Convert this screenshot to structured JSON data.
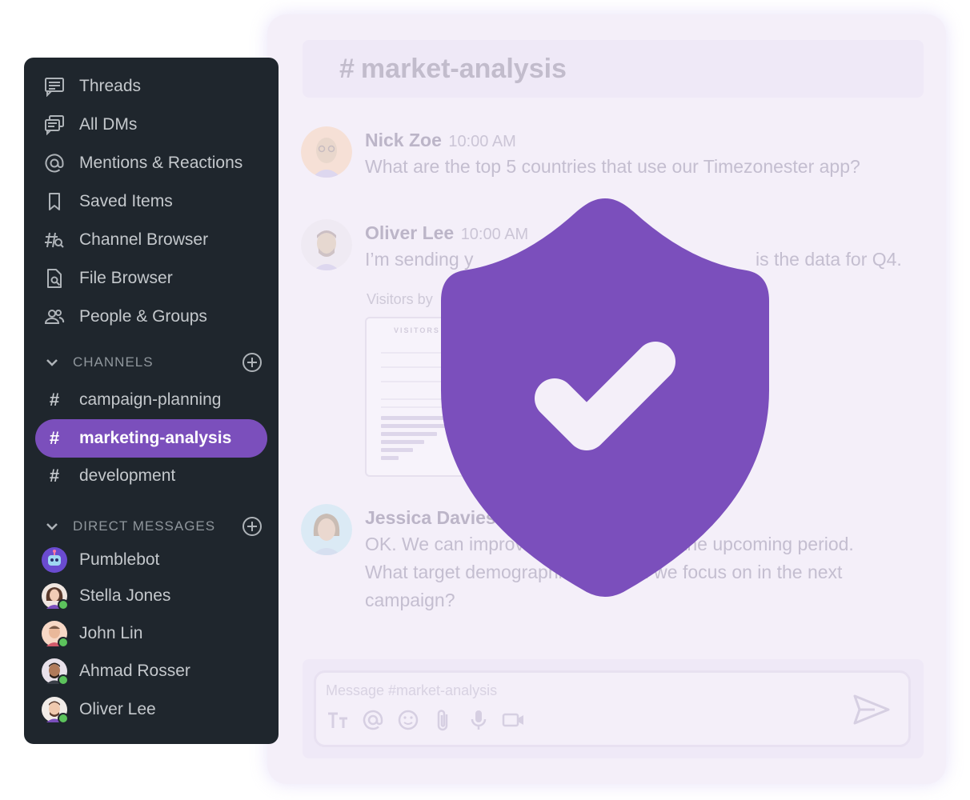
{
  "sidebar": {
    "nav": [
      {
        "label": "Threads",
        "icon": "threads-icon"
      },
      {
        "label": "All DMs",
        "icon": "all-dms-icon"
      },
      {
        "label": "Mentions & Reactions",
        "icon": "at-icon"
      },
      {
        "label": "Saved Items",
        "icon": "bookmark-icon"
      },
      {
        "label": "Channel Browser",
        "icon": "channel-browser-icon"
      },
      {
        "label": "File Browser",
        "icon": "file-search-icon"
      },
      {
        "label": "People & Groups",
        "icon": "people-icon"
      }
    ],
    "channels_header": "CHANNELS",
    "channels": [
      {
        "name": "campaign-planning",
        "active": false
      },
      {
        "name": "marketing-analysis",
        "active": true
      },
      {
        "name": "development",
        "active": false
      }
    ],
    "dms_header": "DIRECT MESSAGES",
    "dms": [
      {
        "name": "Pumblebot",
        "online": false
      },
      {
        "name": "Stella Jones",
        "online": true
      },
      {
        "name": "John Lin",
        "online": true
      },
      {
        "name": "Ahmad Rosser",
        "online": true
      },
      {
        "name": "Oliver Lee",
        "online": true
      }
    ]
  },
  "chat": {
    "channel_hash": "#",
    "channel_name": "market-analysis",
    "messages": [
      {
        "author": "Nick Zoe",
        "time": "10:00 AM",
        "text": "What are the top 5 countries that use our Timezonester app?"
      },
      {
        "author": "Oliver Lee",
        "time": "10:00 AM",
        "text": " I’m sending y",
        "text_tail": "is the data for Q4."
      },
      {
        "author": "Jessica Davies",
        "time": "",
        "text_lines": [
          "OK. We can improve",
          "the upcoming period.",
          "What target demographi",
          "d we focus on in the next",
          "campaign?"
        ]
      }
    ],
    "attachment_label": "Visitors by",
    "attachment_card_title": "VISITORS B",
    "composer_placeholder": "Message #market-analysis"
  },
  "colors": {
    "accent": "#7b4fbc",
    "sidebar_bg": "#1f262d",
    "panel_bg": "#f4eff9",
    "online": "#5cc35c"
  },
  "overlay": {
    "icon": "shield-check-icon"
  }
}
